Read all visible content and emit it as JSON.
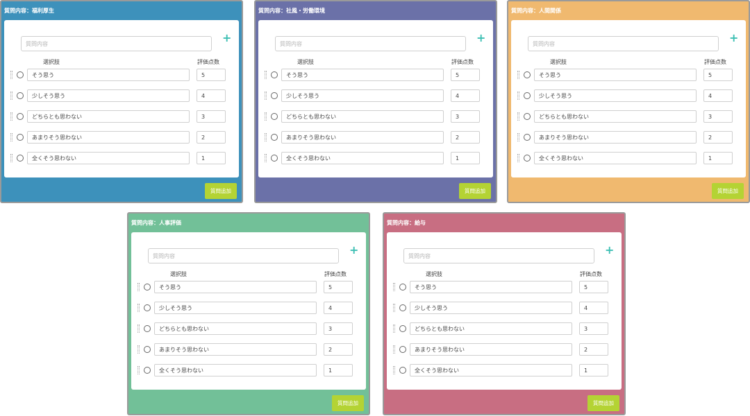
{
  "panels": [
    {
      "title": "質問内容：福利厚生",
      "color": "#3d91bb",
      "question_placeholder": "質問内容",
      "col_choice": "選択肢",
      "col_score": "評価点数",
      "add_button": "質問追加",
      "options": [
        {
          "label": "そう思う",
          "score": "5"
        },
        {
          "label": "少しそう思う",
          "score": "4"
        },
        {
          "label": "どちらとも思わない",
          "score": "3"
        },
        {
          "label": "あまりそう思わない",
          "score": "2"
        },
        {
          "label": "全くそう思わない",
          "score": "1"
        }
      ]
    },
    {
      "title": "質問内容：社風・労働環境",
      "color": "#6b71a8",
      "question_placeholder": "質問内容",
      "col_choice": "選択肢",
      "col_score": "評価点数",
      "add_button": "質問追加",
      "options": [
        {
          "label": "そう思う",
          "score": "5"
        },
        {
          "label": "少しそう思う",
          "score": "4"
        },
        {
          "label": "どちらとも思わない",
          "score": "3"
        },
        {
          "label": "あまりそう思わない",
          "score": "2"
        },
        {
          "label": "全くそう思わない",
          "score": "1"
        }
      ]
    },
    {
      "title": "質問内容：人間関係",
      "color": "#f0b96f",
      "question_placeholder": "質問内容",
      "col_choice": "選択肢",
      "col_score": "評価点数",
      "add_button": "質問追加",
      "options": [
        {
          "label": "そう思う",
          "score": "5"
        },
        {
          "label": "少しそう思う",
          "score": "4"
        },
        {
          "label": "どちらとも思わない",
          "score": "3"
        },
        {
          "label": "あまりそう思わない",
          "score": "2"
        },
        {
          "label": "全くそう思わない",
          "score": "1"
        }
      ]
    },
    {
      "title": "質問内容：人事評価",
      "color": "#72c098",
      "question_placeholder": "質問内容",
      "col_choice": "選択肢",
      "col_score": "評価点数",
      "add_button": "質問追加",
      "options": [
        {
          "label": "そう思う",
          "score": "5"
        },
        {
          "label": "少しそう思う",
          "score": "4"
        },
        {
          "label": "どちらとも思わない",
          "score": "3"
        },
        {
          "label": "あまりそう思わない",
          "score": "2"
        },
        {
          "label": "全くそう思わない",
          "score": "1"
        }
      ]
    },
    {
      "title": "質問内容：給与",
      "color": "#c86e82",
      "question_placeholder": "質問内容",
      "col_choice": "選択肢",
      "col_score": "評価点数",
      "add_button": "質問追加",
      "options": [
        {
          "label": "そう思う",
          "score": "5"
        },
        {
          "label": "少しそう思う",
          "score": "4"
        },
        {
          "label": "どちらとも思わない",
          "score": "3"
        },
        {
          "label": "あまりそう思わない",
          "score": "2"
        },
        {
          "label": "全くそう思わない",
          "score": "1"
        }
      ]
    }
  ],
  "icons": {
    "add_choice": "plus-icon",
    "drag_handle": "drag-handle-icon",
    "radio": "radio-circle"
  }
}
